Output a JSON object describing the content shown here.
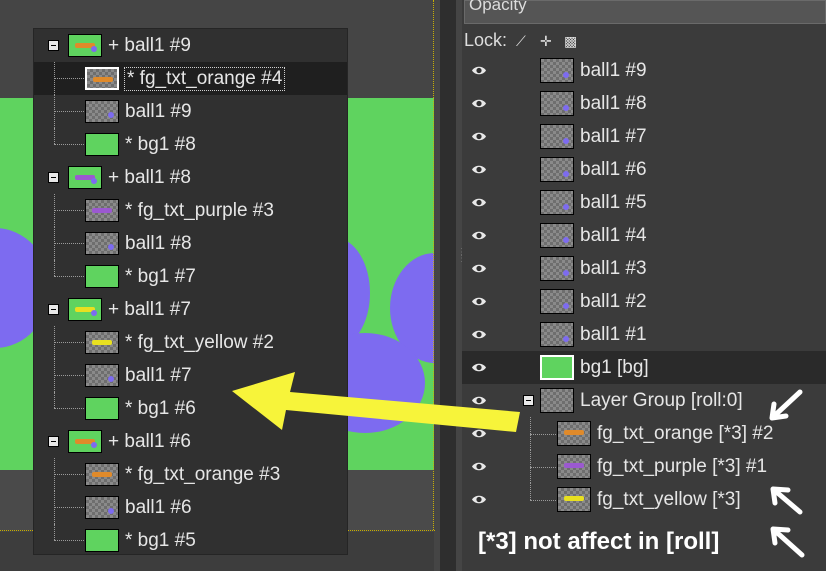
{
  "panel": {
    "opacity_label": "Opacity",
    "lock_label": "Lock:",
    "lock_icons": [
      "pencil-icon",
      "move-icon",
      "checker-icon"
    ]
  },
  "popup_tree": [
    {
      "label": "+ ball1 #9",
      "kind": "group",
      "thumb": "green-text-orange"
    },
    {
      "label": "* fg_txt_orange  #4",
      "kind": "child",
      "thumb": "check-text-orange",
      "selected": true
    },
    {
      "label": "ball1 #9",
      "kind": "child",
      "thumb": "check-dot"
    },
    {
      "label": "* bg1 #8",
      "kind": "child-last",
      "thumb": "green"
    },
    {
      "label": "+ ball1 #8",
      "kind": "group",
      "thumb": "green-text-purple"
    },
    {
      "label": "* fg_txt_purple  #3",
      "kind": "child",
      "thumb": "check-text-purple"
    },
    {
      "label": "ball1 #8",
      "kind": "child",
      "thumb": "check-dot"
    },
    {
      "label": "* bg1 #7",
      "kind": "child-last",
      "thumb": "green"
    },
    {
      "label": "+ ball1 #7",
      "kind": "group",
      "thumb": "green-text-yellow"
    },
    {
      "label": "* fg_txt_yellow #2",
      "kind": "child",
      "thumb": "check-text-yellow"
    },
    {
      "label": "ball1 #7",
      "kind": "child",
      "thumb": "check-dot"
    },
    {
      "label": "* bg1 #6",
      "kind": "child-last",
      "thumb": "green"
    },
    {
      "label": "+ ball1 #6",
      "kind": "group",
      "thumb": "green-text-orange"
    },
    {
      "label": "* fg_txt_orange  #3",
      "kind": "child",
      "thumb": "check-text-orange"
    },
    {
      "label": "ball1 #6",
      "kind": "child",
      "thumb": "check-dot"
    },
    {
      "label": "* bg1 #5",
      "kind": "child-last",
      "thumb": "green"
    }
  ],
  "layers": [
    {
      "label": "ball1 #9",
      "thumb": "check-dot",
      "indent": 1
    },
    {
      "label": "ball1 #8",
      "thumb": "check-dot",
      "indent": 1
    },
    {
      "label": "ball1 #7",
      "thumb": "check-dot",
      "indent": 1
    },
    {
      "label": "ball1 #6",
      "thumb": "check-dot",
      "indent": 1
    },
    {
      "label": "ball1 #5",
      "thumb": "check-dot",
      "indent": 1
    },
    {
      "label": "ball1 #4",
      "thumb": "check-dot",
      "indent": 1
    },
    {
      "label": "ball1 #3",
      "thumb": "check-dot",
      "indent": 1
    },
    {
      "label": "ball1 #2",
      "thumb": "check-dot",
      "indent": 1
    },
    {
      "label": "ball1 #1",
      "thumb": "check-dot",
      "indent": 1
    },
    {
      "label": "bg1 [bg]",
      "thumb": "green",
      "indent": 1,
      "selected": true
    },
    {
      "label": "Layer Group [roll:0]",
      "thumb": "check",
      "indent": 1,
      "group": true
    },
    {
      "label": "fg_txt_orange [*3] #2",
      "thumb": "check-text-orange",
      "indent": 2
    },
    {
      "label": "fg_txt_purple [*3] #1",
      "thumb": "check-text-purple",
      "indent": 2
    },
    {
      "label": "fg_txt_yellow [*3]",
      "thumb": "check-text-yellow",
      "indent": 2
    }
  ],
  "annotation": {
    "note": "[*3] not affect in [roll]",
    "arrow_color": "#f7f43a",
    "note_color": "#ffffff"
  },
  "colors": {
    "canvas_green": "#5fd35f",
    "ball_purple": "#7d6bf0",
    "txt_orange": "#e08a2a",
    "txt_purple": "#9b59d0",
    "txt_yellow": "#e8e020"
  }
}
